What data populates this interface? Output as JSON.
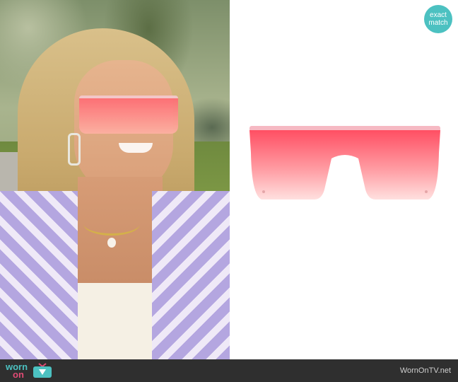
{
  "badge": {
    "line1": "exact",
    "line2": "match",
    "color": "#4cc1c1"
  },
  "footer": {
    "logo_part1": "worn",
    "logo_part2": "on",
    "logo_icon": "tv-icon",
    "site_url": "WornOnTV.net"
  },
  "colors": {
    "brand_teal": "#4cc1c1",
    "brand_pink": "#e24b75",
    "footer_bg": "#2f2f2f",
    "lens_top": "#ff5a6a",
    "lens_bottom": "#ffd3d3",
    "frame_pink": "#f6b9c3"
  },
  "images": {
    "left_photo": "woman-in-sunglasses-photo",
    "right_product": "pink-shield-sunglasses"
  }
}
